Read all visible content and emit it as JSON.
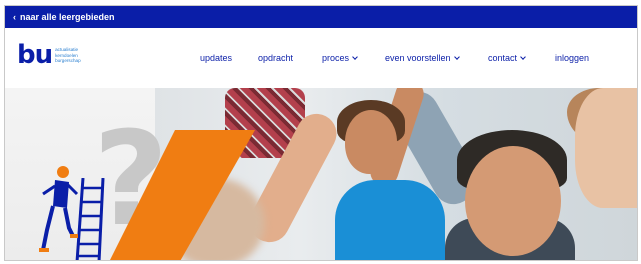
{
  "topbar": {
    "back_label": "naar alle leergebieden"
  },
  "logo": {
    "mark": "bu",
    "lines": [
      "actualisatie",
      "kerndoelen",
      "burgerschap"
    ]
  },
  "menu": {
    "items": [
      {
        "label": "updates",
        "has_caret": false
      },
      {
        "label": "opdracht",
        "has_caret": false
      },
      {
        "label": "proces",
        "has_caret": true
      },
      {
        "label": "even voorstellen",
        "has_caret": true
      },
      {
        "label": "contact",
        "has_caret": true
      },
      {
        "label": "inloggen",
        "has_caret": false
      }
    ]
  },
  "hero": {
    "illustration_mark": "?"
  },
  "colors": {
    "brand_blue": "#0a1ea8",
    "accent_orange": "#f07d12",
    "logo_text_blue": "#2a7fd0"
  }
}
